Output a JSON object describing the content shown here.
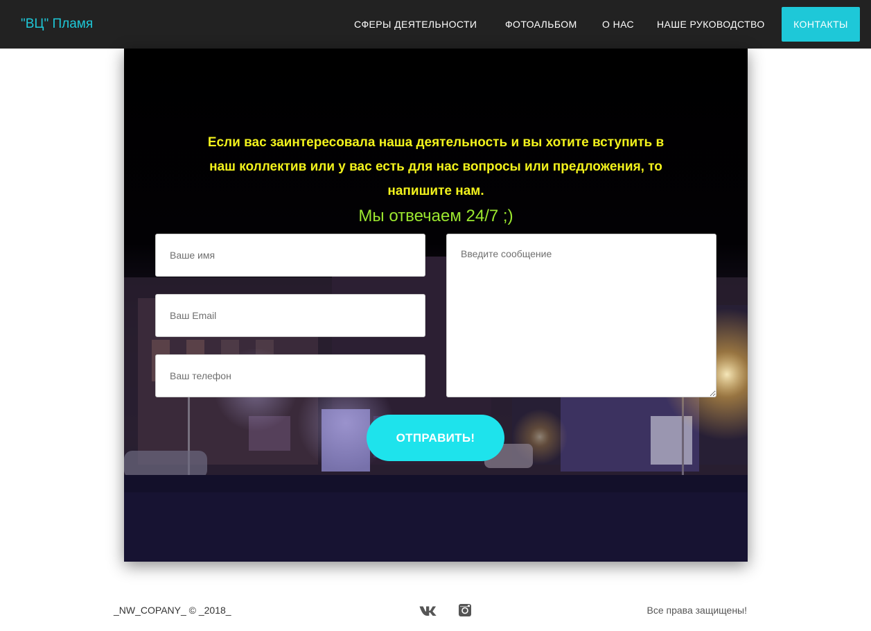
{
  "header": {
    "brand": "\"ВЦ\" Пламя",
    "nav": [
      {
        "label": "СФЕРЫ ДЕЯТЕЛЬНОСТИ"
      },
      {
        "label": "ФОТОАЛЬБОМ"
      },
      {
        "label": "О НАС"
      },
      {
        "label": "НАШЕ РУКОВОДСТВО"
      },
      {
        "label": "КОНТАКТЫ",
        "active": true
      }
    ]
  },
  "contact": {
    "intro": "Если вас заинтересовала наша деятельность и вы хотите вступить в наш коллектив или у вас есть для нас вопросы или предложения, то напишите нам.",
    "tagline": "Мы отвечаем 24/7 ;)",
    "form": {
      "name_placeholder": "Ваше имя",
      "email_placeholder": "Ваш Email",
      "phone_placeholder": "Ваш телефон",
      "message_placeholder": "Введите сообщение",
      "submit_label": "ОТПРАВИТЬ!"
    }
  },
  "footer": {
    "copyright": "_NW_COPANY_ © _2018_",
    "rights": "Все права защищены!",
    "social": [
      {
        "icon": "vk-icon"
      },
      {
        "icon": "instagram-icon"
      }
    ]
  },
  "colors": {
    "accent": "#1ec8d8",
    "button": "#1ee3ec",
    "intro_text": "#f2f21c",
    "tagline_text": "#9be72f",
    "navbar": "#222222"
  }
}
